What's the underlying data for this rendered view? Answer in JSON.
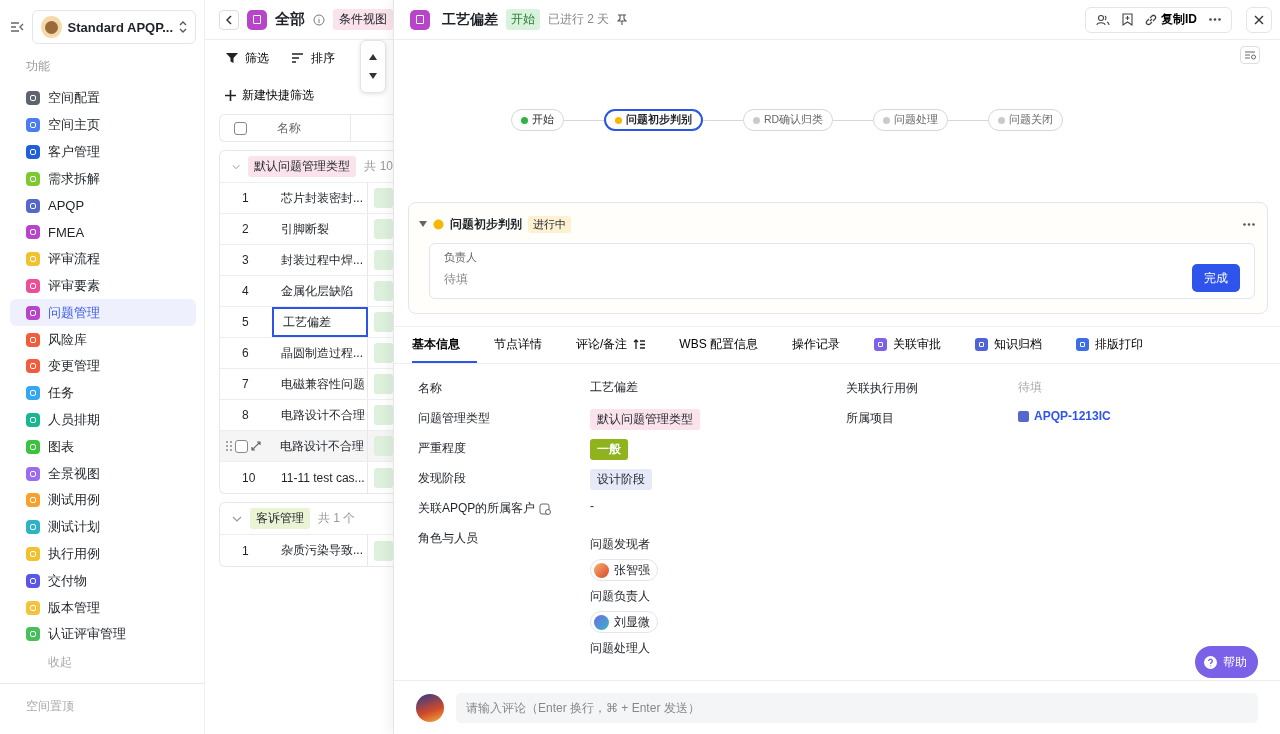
{
  "sidebar": {
    "space_name": "Standard APQP...",
    "section_label": "功能",
    "items": [
      {
        "label": "空间配置",
        "color": "#5f6370",
        "selected": false
      },
      {
        "label": "空间主页",
        "color": "#4c7df0",
        "selected": false
      },
      {
        "label": "客户管理",
        "color": "#1f5fd8",
        "selected": false
      },
      {
        "label": "需求拆解",
        "color": "#7cc932",
        "selected": false
      },
      {
        "label": "APQP",
        "color": "#5468c9",
        "selected": false
      },
      {
        "label": "FMEA",
        "color": "#b845c9",
        "selected": false
      },
      {
        "label": "评审流程",
        "color": "#f2c12e",
        "selected": false
      },
      {
        "label": "评审要素",
        "color": "#ee4d9a",
        "selected": false
      },
      {
        "label": "问题管理",
        "color": "#b845c9",
        "selected": true
      },
      {
        "label": "风险库",
        "color": "#f25c3c",
        "selected": false
      },
      {
        "label": "变更管理",
        "color": "#f25c3c",
        "selected": false
      },
      {
        "label": "任务",
        "color": "#34a7f0",
        "selected": false
      },
      {
        "label": "人员排期",
        "color": "#17b890",
        "selected": false
      },
      {
        "label": "图表",
        "color": "#3cc23c",
        "selected": false
      },
      {
        "label": "全景视图",
        "color": "#9b6cf0",
        "selected": false
      },
      {
        "label": "测试用例",
        "color": "#f7a02c",
        "selected": false
      },
      {
        "label": "测试计划",
        "color": "#2cb4c6",
        "selected": false
      },
      {
        "label": "执行用例",
        "color": "#f2c12e",
        "selected": false
      },
      {
        "label": "交付物",
        "color": "#5a56e8",
        "selected": false
      },
      {
        "label": "版本管理",
        "color": "#f5c33b",
        "selected": false
      },
      {
        "label": "认证评审管理",
        "color": "#46c05a",
        "selected": false
      }
    ],
    "collapse_label": "收起",
    "pinned_label": "空间置顶"
  },
  "list": {
    "title": "全部",
    "view_tag": "条件视图",
    "toolbar": [
      "筛选",
      "排序"
    ],
    "new_filter": "新建快捷筛选",
    "columns": [
      "名称"
    ],
    "all_checked": false,
    "groups": [
      {
        "tag": "默认问题管理类型",
        "color": "#fbe3ec",
        "count": "共 10",
        "rows": [
          {
            "index": "1",
            "name": "芯片封装密封...",
            "selected": false,
            "hovered": false
          },
          {
            "index": "2",
            "name": "引脚断裂",
            "selected": false,
            "hovered": false
          },
          {
            "index": "3",
            "name": "封装过程中焊...",
            "selected": false,
            "hovered": false
          },
          {
            "index": "4",
            "name": "金属化层缺陷",
            "selected": false,
            "hovered": false
          },
          {
            "index": "5",
            "name": "工艺偏差",
            "selected": true,
            "hovered": false
          },
          {
            "index": "6",
            "name": "晶圆制造过程...",
            "selected": false,
            "hovered": false
          },
          {
            "index": "7",
            "name": "电磁兼容性问题",
            "selected": false,
            "hovered": false
          },
          {
            "index": "8",
            "name": "电路设计不合理",
            "selected": false,
            "hovered": false
          },
          {
            "name": "电路设计不合理",
            "selected": false,
            "hovered": true,
            "checked": false
          },
          {
            "index": "10",
            "name": "11-11 test cas...",
            "selected": false,
            "hovered": false
          }
        ]
      },
      {
        "tag": "客诉管理",
        "color": "#eaf3d4",
        "count": "共 1 个",
        "rows": [
          {
            "index": "1",
            "name": "杂质污染导致...",
            "selected": false,
            "hovered": false
          }
        ]
      }
    ]
  },
  "detail": {
    "title": "工艺偏差",
    "status": "开始",
    "elapsed": "已进行 2 天",
    "copy_id": "复制ID",
    "stages": [
      {
        "label": "开始",
        "reached": true,
        "current": false
      },
      {
        "label": "问题初步判别",
        "current": true
      },
      {
        "label": "RD确认归类",
        "reached": false,
        "current": false
      },
      {
        "label": "问题处理",
        "reached": false,
        "current": false
      },
      {
        "label": "问题关闭",
        "reached": false,
        "current": false
      }
    ],
    "stage_card": {
      "name": "问题初步判别",
      "status": "进行中",
      "expanded": true,
      "field_label": "负责人",
      "field_placeholder": "待填",
      "button": "完成"
    },
    "tabs": [
      {
        "label": "基本信息",
        "selected": true,
        "kind": "plain"
      },
      {
        "label": "节点详情",
        "selected": false,
        "kind": "plain"
      },
      {
        "label": "评论/备注",
        "selected": false,
        "kind": "sort"
      },
      {
        "label": "WBS 配置信息",
        "selected": false,
        "kind": "plain"
      },
      {
        "label": "操作记录",
        "selected": false,
        "kind": "plain"
      },
      {
        "label": "关联审批",
        "selected": false,
        "kind": "approval"
      },
      {
        "label": "知识归档",
        "selected": false,
        "kind": "archive"
      },
      {
        "label": "排版打印",
        "selected": false,
        "kind": "print"
      }
    ],
    "fields_left": [
      {
        "label": "名称",
        "kind": "text",
        "value": "工艺偏差"
      },
      {
        "label": "问题管理类型",
        "kind": "tag",
        "value": "默认问题管理类型",
        "color": "#fbe3ec"
      },
      {
        "label": "严重程度",
        "kind": "solid_tag",
        "value": "一般",
        "color": "#8fb31c"
      },
      {
        "label": "发现阶段",
        "kind": "tag",
        "value": "设计阶段",
        "color": "#e6e9f8"
      },
      {
        "label": "关联APQP的所属客户",
        "kind": "text",
        "value": "-",
        "linked": true
      },
      {
        "label": "角色与人员",
        "kind": "roles",
        "roles": [
          {
            "role": "问题发现者",
            "person": "张智强"
          },
          {
            "role": "问题负责人",
            "person": "刘显微"
          },
          {
            "role": "问题处理人"
          }
        ]
      }
    ],
    "fields_right": [
      {
        "label": "关联执行用例",
        "kind": "empty",
        "placeholder": "待填"
      },
      {
        "label": "所属项目",
        "kind": "link",
        "value": "APQP-1213IC"
      }
    ],
    "comment_placeholder": "请输入评论（Enter 换行，⌘ + Enter 发送）",
    "help": "帮助"
  }
}
